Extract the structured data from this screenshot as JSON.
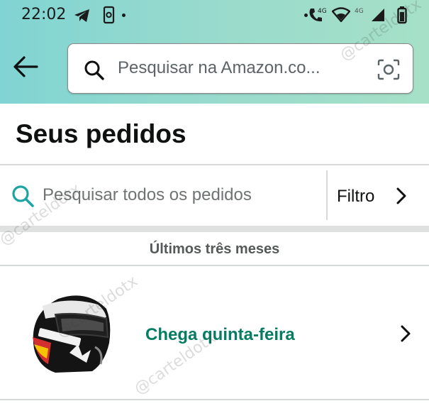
{
  "status_bar": {
    "time": "22:02",
    "network_label_1": "4G",
    "network_label_2": "4G",
    "icons": [
      "telegram-icon",
      "phone-screen-icon",
      "call-volte-icon",
      "wifi-icon",
      "signal-icon",
      "battery-icon"
    ]
  },
  "header": {
    "back_icon": "arrow-left-icon",
    "search_placeholder": "Pesquisar na Amazon.co...",
    "camera_icon": "camera-scan-icon"
  },
  "page": {
    "title": "Seus pedidos",
    "orders_search_placeholder": "Pesquisar todos os pedidos",
    "filter_label": "Filtro",
    "period_label": "Últimos três meses"
  },
  "orders": [
    {
      "image": "motorcycle-helmet-image",
      "delivery_text": "Chega quinta-feira"
    }
  ],
  "watermark": "@carteldotx",
  "colors": {
    "header_gradient_start": "#80d4d3",
    "header_gradient_end": "#a6e0c7",
    "delivery_green": "#067d62",
    "search_icon_teal": "#1ca4a4",
    "divider": "#d5d9d9"
  }
}
